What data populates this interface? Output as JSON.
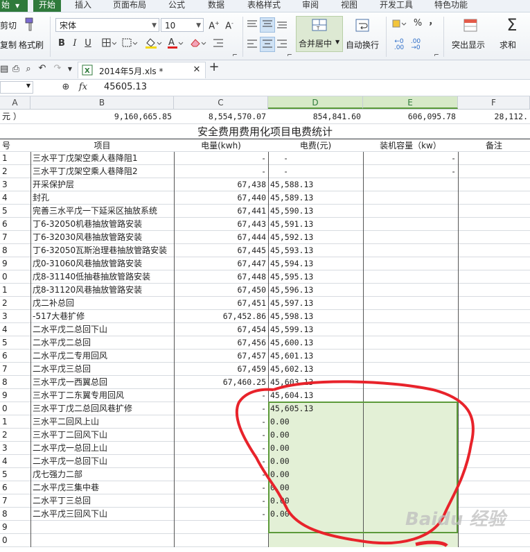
{
  "menu": {
    "app_button": "始",
    "items": [
      "开始",
      "插入",
      "页面布局",
      "公式",
      "数据",
      "表格样式",
      "审阅",
      "视图",
      "开发工具",
      "特色功能"
    ]
  },
  "ribbon": {
    "cut": "剪切",
    "copy": "复制",
    "format_painter": "格式刷",
    "font_name": "宋体",
    "font_size": "10",
    "merge_center": "合并居中",
    "wrap_text": "自动换行",
    "number_symbols": [
      "%",
      "，"
    ],
    "conditional": "突出显示",
    "sum": "求和",
    "sum_symbol": "Σ"
  },
  "document": {
    "tab_title": "2014年5月.xls *",
    "new_tab": "+"
  },
  "formula_bar": {
    "fx": "fx",
    "value": "45605.13"
  },
  "columns": [
    "A",
    "B",
    "C",
    "D",
    "E",
    "F"
  ],
  "totals_row": {
    "a": "元 ）",
    "b": "9,160,665.85",
    "c": "8,554,570.07",
    "d": "854,841.60",
    "e": "606,095.78",
    "f": "28,112."
  },
  "table_title": "安全费用费用化项目电费统计",
  "headers": {
    "seq": "号",
    "project": "项目",
    "kwh": "电量(kwh)",
    "fee": "电费(元)",
    "capacity": "装机容量（kw）",
    "note": "备注"
  },
  "rows": [
    {
      "n": "1",
      "project": "三水平丁戊架空乘人巷降阻1",
      "kwh": "-",
      "fee": "-",
      "cap": "-"
    },
    {
      "n": "2",
      "project": "三水平丁戊架空乘人巷降阻2",
      "kwh": "-",
      "fee": "-",
      "cap": "-"
    },
    {
      "n": "3",
      "project": "开采保护层",
      "kwh": "67,438",
      "fee": "45,588.13",
      "cap": ""
    },
    {
      "n": "4",
      "project": "封孔",
      "kwh": "67,440",
      "fee": "45,589.13",
      "cap": ""
    },
    {
      "n": "5",
      "project": "完善三水平戊一下延采区抽放系统",
      "kwh": "67,441",
      "fee": "45,590.13",
      "cap": ""
    },
    {
      "n": "6",
      "project": "丁6-32050机巷抽放管路安装",
      "kwh": "67,443",
      "fee": "45,591.13",
      "cap": ""
    },
    {
      "n": "7",
      "project": "丁6-32030风巷抽放管路安装",
      "kwh": "67,444",
      "fee": "45,592.13",
      "cap": ""
    },
    {
      "n": "8",
      "project": "丁6-32050瓦斯治理巷抽放管路安装",
      "kwh": "67,445",
      "fee": "45,593.13",
      "cap": ""
    },
    {
      "n": "9",
      "project": "戊0-31060风巷抽放管路安装",
      "kwh": "67,447",
      "fee": "45,594.13",
      "cap": ""
    },
    {
      "n": "0",
      "project": "戊8-31140低抽巷抽放管路安装",
      "kwh": "67,448",
      "fee": "45,595.13",
      "cap": ""
    },
    {
      "n": "1",
      "project": "戊8-31120风巷抽放管路安装",
      "kwh": "67,450",
      "fee": "45,596.13",
      "cap": ""
    },
    {
      "n": "2",
      "project": "戊二补总回",
      "kwh": "67,451",
      "fee": "45,597.13",
      "cap": ""
    },
    {
      "n": "3",
      "project": "-517大巷扩修",
      "kwh": "67,452.86",
      "fee": "45,598.13",
      "cap": ""
    },
    {
      "n": "4",
      "project": "二水平戊二总回下山",
      "kwh": "67,454",
      "fee": "45,599.13",
      "cap": ""
    },
    {
      "n": "5",
      "project": "二水平戊二总回",
      "kwh": "67,456",
      "fee": "45,600.13",
      "cap": ""
    },
    {
      "n": "6",
      "project": "二水平戊二专用回风",
      "kwh": "67,457",
      "fee": "45,601.13",
      "cap": ""
    },
    {
      "n": "7",
      "project": "二水平戊三总回",
      "kwh": "67,459",
      "fee": "45,602.13",
      "cap": ""
    },
    {
      "n": "8",
      "project": "三水平戊一西翼总回",
      "kwh": "67,460.25",
      "fee": "45,603.13",
      "cap": ""
    },
    {
      "n": "9",
      "project": "三水平丁二东翼专用回风",
      "kwh": "-",
      "fee": "45,604.13",
      "cap": ""
    },
    {
      "n": "0",
      "project": "三水平丁戊二总回风巷扩修",
      "kwh": "-",
      "fee": "45,605.13",
      "cap": ""
    },
    {
      "n": "1",
      "project": "三水平二回风上山",
      "kwh": "-",
      "fee": "0.00",
      "cap": ""
    },
    {
      "n": "2",
      "project": "三水平丁二回风下山",
      "kwh": "-",
      "fee": "0.00",
      "cap": ""
    },
    {
      "n": "3",
      "project": "二水平戊一总回上山",
      "kwh": "-",
      "fee": "0.00",
      "cap": ""
    },
    {
      "n": "4",
      "project": "二水平戊一总回下山",
      "kwh": "-",
      "fee": "0.00",
      "cap": ""
    },
    {
      "n": "5",
      "project": "戊七强力二部",
      "kwh": "-",
      "fee": "0.00",
      "cap": ""
    },
    {
      "n": "6",
      "project": "二水平戊三集中巷",
      "kwh": "-",
      "fee": "0.00",
      "cap": ""
    },
    {
      "n": "7",
      "project": "二水平丁三总回",
      "kwh": "-",
      "fee": "0.00",
      "cap": ""
    },
    {
      "n": "8",
      "project": "二水平戊三回风下山",
      "kwh": "-",
      "fee": "0.00",
      "cap": ""
    },
    {
      "n": "9",
      "project": "",
      "kwh": "",
      "fee": "",
      "cap": ""
    },
    {
      "n": "0",
      "project": "",
      "kwh": "",
      "fee": "",
      "cap": ""
    }
  ],
  "watermark": "Baidu 经验",
  "colors": {
    "accent_green": "#2f7a3b",
    "selection_border": "#5c9a3a",
    "selection_fill": "#e3f0d6",
    "annotation_red": "#e8232b"
  }
}
